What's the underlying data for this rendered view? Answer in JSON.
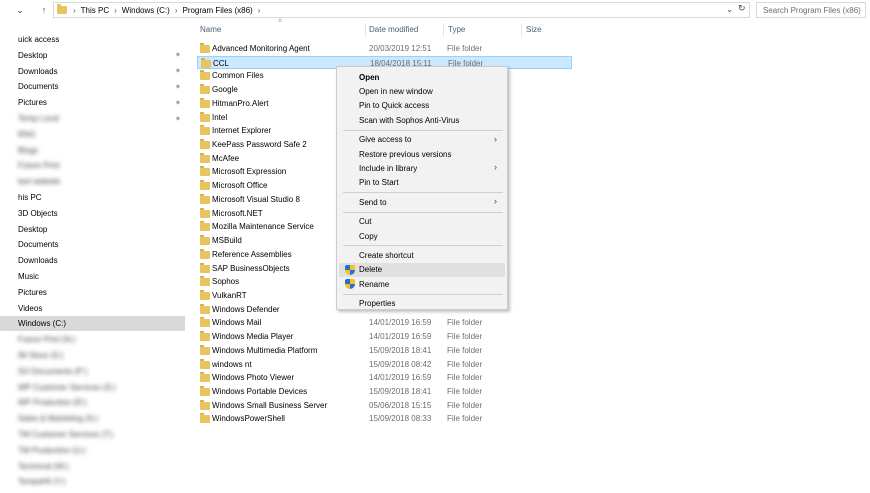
{
  "address": {
    "crumbs": [
      "This PC",
      "Windows (C:)",
      "Program Files (x86)"
    ],
    "search_placeholder": "Search Program Files (x86)"
  },
  "sidebar": {
    "items": [
      {
        "label": "uick access",
        "blur": false,
        "pin": false,
        "selected": false
      },
      {
        "label": "Desktop",
        "blur": false,
        "pin": true,
        "selected": false
      },
      {
        "label": "Downloads",
        "blur": false,
        "pin": true,
        "selected": false
      },
      {
        "label": "Documents",
        "blur": false,
        "pin": true,
        "selected": false
      },
      {
        "label": "Pictures",
        "blur": false,
        "pin": true,
        "selected": false
      },
      {
        "label": "Temp Local",
        "blur": true,
        "pin": true,
        "selected": false
      },
      {
        "label": "RNG",
        "blur": true,
        "pin": false,
        "selected": false
      },
      {
        "label": "Blogs",
        "blur": true,
        "pin": false,
        "selected": false
      },
      {
        "label": "Future Print",
        "blur": true,
        "pin": false,
        "selected": false
      },
      {
        "label": "test website",
        "blur": true,
        "pin": false,
        "selected": false
      },
      {
        "label": "his PC",
        "blur": false,
        "pin": false,
        "selected": false
      },
      {
        "label": "3D Objects",
        "blur": false,
        "pin": false,
        "selected": false
      },
      {
        "label": "Desktop",
        "blur": false,
        "pin": false,
        "selected": false
      },
      {
        "label": "Documents",
        "blur": false,
        "pin": false,
        "selected": false
      },
      {
        "label": "Downloads",
        "blur": false,
        "pin": false,
        "selected": false
      },
      {
        "label": "Music",
        "blur": false,
        "pin": false,
        "selected": false
      },
      {
        "label": "Pictures",
        "blur": false,
        "pin": false,
        "selected": false
      },
      {
        "label": "Videos",
        "blur": false,
        "pin": false,
        "selected": false
      },
      {
        "label": "Windows (C:)",
        "blur": false,
        "pin": false,
        "selected": true
      },
      {
        "label": "Future Print (N:)",
        "blur": true,
        "pin": false,
        "selected": false
      },
      {
        "label": "IM Store (S:)",
        "blur": true,
        "pin": false,
        "selected": false
      },
      {
        "label": "SO Documents (P:)",
        "blur": true,
        "pin": false,
        "selected": false
      },
      {
        "label": "WP Customer Services (S:)",
        "blur": true,
        "pin": false,
        "selected": false
      },
      {
        "label": "WP Production (R:)",
        "blur": true,
        "pin": false,
        "selected": false
      },
      {
        "label": "Sales & Marketing (S:)",
        "blur": true,
        "pin": false,
        "selected": false
      },
      {
        "label": "TM Customer Services (T:)",
        "blur": true,
        "pin": false,
        "selected": false
      },
      {
        "label": "TM Production (U:)",
        "blur": true,
        "pin": false,
        "selected": false
      },
      {
        "label": "Technical (W:)",
        "blur": true,
        "pin": false,
        "selected": false
      },
      {
        "label": "Tempdrift (Y:)",
        "blur": true,
        "pin": false,
        "selected": false
      }
    ]
  },
  "columns": {
    "name": "Name",
    "date": "Date modified",
    "type": "Type",
    "size": "Size"
  },
  "files": [
    {
      "name": "Advanced Monitoring Agent",
      "date": "20/03/2019 12:51",
      "type": "File folder"
    },
    {
      "name": "CCL",
      "date": "18/04/2018 15:11",
      "type": "File folder"
    },
    {
      "name": "Common Files",
      "date": "",
      "type": ""
    },
    {
      "name": "Google",
      "date": "",
      "type": ""
    },
    {
      "name": "HitmanPro.Alert",
      "date": "",
      "type": ""
    },
    {
      "name": "Intel",
      "date": "",
      "type": ""
    },
    {
      "name": "Internet Explorer",
      "date": "",
      "type": ""
    },
    {
      "name": "KeePass Password Safe 2",
      "date": "",
      "type": ""
    },
    {
      "name": "McAfee",
      "date": "",
      "type": ""
    },
    {
      "name": "Microsoft Expression",
      "date": "",
      "type": ""
    },
    {
      "name": "Microsoft Office",
      "date": "",
      "type": ""
    },
    {
      "name": "Microsoft Visual Studio 8",
      "date": "",
      "type": ""
    },
    {
      "name": "Microsoft.NET",
      "date": "",
      "type": ""
    },
    {
      "name": "Mozilla Maintenance Service",
      "date": "",
      "type": ""
    },
    {
      "name": "MSBuild",
      "date": "",
      "type": ""
    },
    {
      "name": "Reference Assemblies",
      "date": "",
      "type": ""
    },
    {
      "name": "SAP BusinessObjects",
      "date": "",
      "type": ""
    },
    {
      "name": "Sophos",
      "date": "",
      "type": ""
    },
    {
      "name": "VulkanRT",
      "date": "",
      "type": ""
    },
    {
      "name": "Windows Defender",
      "date": "",
      "type": ""
    },
    {
      "name": "Windows Mail",
      "date": "14/01/2019 16:59",
      "type": "File folder"
    },
    {
      "name": "Windows Media Player",
      "date": "14/01/2019 16:59",
      "type": "File folder"
    },
    {
      "name": "Windows Multimedia Platform",
      "date": "15/09/2018 18:41",
      "type": "File folder"
    },
    {
      "name": "windows nt",
      "date": "15/09/2018 08:42",
      "type": "File folder"
    },
    {
      "name": "Windows Photo Viewer",
      "date": "14/01/2019 16:59",
      "type": "File folder"
    },
    {
      "name": "Windows Portable Devices",
      "date": "15/09/2018 18:41",
      "type": "File folder"
    },
    {
      "name": "Windows Small Business Server",
      "date": "05/06/2018 15:15",
      "type": "File folder"
    },
    {
      "name": "WindowsPowerShell",
      "date": "15/09/2018 08:33",
      "type": "File folder"
    }
  ],
  "context_menu": {
    "items": [
      {
        "label": "Open",
        "bold": true,
        "submenu": false,
        "icon": "",
        "hover": false
      },
      {
        "label": "Open in new window",
        "bold": false,
        "submenu": false,
        "icon": "",
        "hover": false
      },
      {
        "label": "Pin to Quick access",
        "bold": false,
        "submenu": false,
        "icon": "",
        "hover": false
      },
      {
        "label": "Scan with Sophos Anti-Virus",
        "bold": false,
        "submenu": false,
        "icon": "",
        "hover": false
      },
      {
        "sep": true
      },
      {
        "label": "Give access to",
        "bold": false,
        "submenu": true,
        "icon": "",
        "hover": false
      },
      {
        "label": "Restore previous versions",
        "bold": false,
        "submenu": false,
        "icon": "",
        "hover": false
      },
      {
        "label": "Include in library",
        "bold": false,
        "submenu": true,
        "icon": "",
        "hover": false
      },
      {
        "label": "Pin to Start",
        "bold": false,
        "submenu": false,
        "icon": "",
        "hover": false
      },
      {
        "sep": true
      },
      {
        "label": "Send to",
        "bold": false,
        "submenu": true,
        "icon": "",
        "hover": false
      },
      {
        "sep": true
      },
      {
        "label": "Cut",
        "bold": false,
        "submenu": false,
        "icon": "",
        "hover": false
      },
      {
        "label": "Copy",
        "bold": false,
        "submenu": false,
        "icon": "",
        "hover": false
      },
      {
        "sep": true
      },
      {
        "label": "Create shortcut",
        "bold": false,
        "submenu": false,
        "icon": "",
        "hover": false
      },
      {
        "label": "Delete",
        "bold": false,
        "submenu": false,
        "icon": "shield-icon",
        "hover": true
      },
      {
        "label": "Rename",
        "bold": false,
        "submenu": false,
        "icon": "shield-icon",
        "hover": false
      },
      {
        "sep": true
      },
      {
        "label": "Properties",
        "bold": false,
        "submenu": false,
        "icon": "",
        "hover": false
      }
    ]
  }
}
